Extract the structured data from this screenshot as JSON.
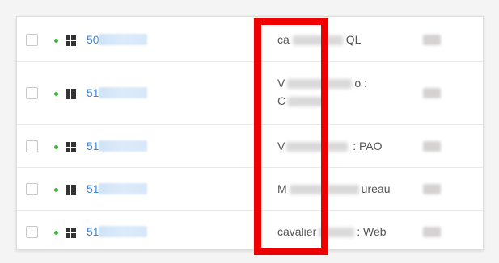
{
  "colors": {
    "status_green": "#3cb83c",
    "link_blue": "#3a86d6",
    "highlight_red": "#ee0000"
  },
  "rows": [
    {
      "id_prefix": "50",
      "desc_start": "ca",
      "desc_end": "QL",
      "desc_line2": ""
    },
    {
      "id_prefix": "51",
      "desc_start": "V",
      "desc_end": "o :",
      "desc_line2": "C"
    },
    {
      "id_prefix": "51",
      "desc_start": "V",
      "desc_end": " : PAO",
      "desc_line2": ""
    },
    {
      "id_prefix": "51",
      "desc_start": "M",
      "desc_end": "ureau",
      "desc_line2": ""
    },
    {
      "id_prefix": "51",
      "desc_start": "cavalier",
      "desc_end": ": Web",
      "desc_line2": ""
    }
  ]
}
